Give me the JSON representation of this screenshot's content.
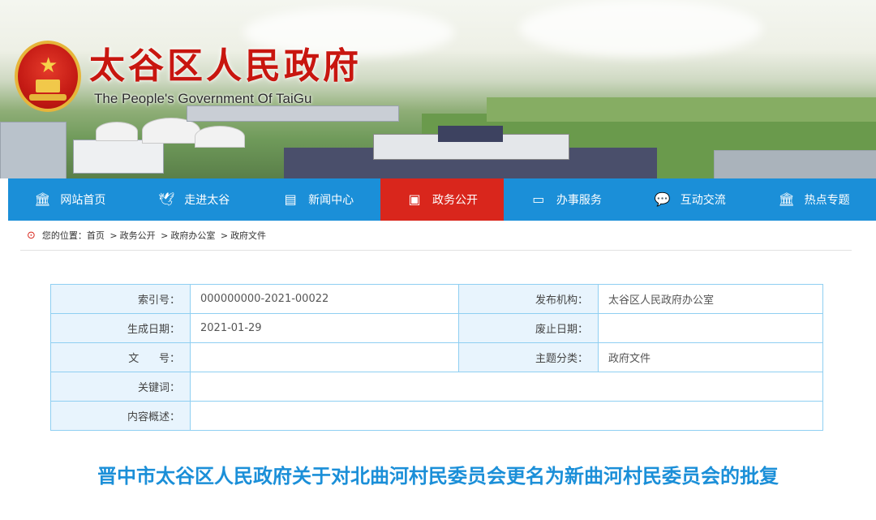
{
  "header": {
    "site_title": "太谷区人民政府",
    "site_subtitle": "The People's Government Of TaiGu"
  },
  "nav": {
    "items": [
      {
        "label": "网站首页",
        "icon": "bank-icon"
      },
      {
        "label": "走进太谷",
        "icon": "dove-icon"
      },
      {
        "label": "新闻中心",
        "icon": "newspaper-icon"
      },
      {
        "label": "政务公开",
        "icon": "document-icon"
      },
      {
        "label": "办事服务",
        "icon": "monitor-icon"
      },
      {
        "label": "互动交流",
        "icon": "chat-icon"
      },
      {
        "label": "热点专题",
        "icon": "bank-icon"
      }
    ],
    "active_index": 3
  },
  "breadcrumb": {
    "prefix": "您的位置：",
    "items": [
      "首页",
      "政务公开",
      "政府办公室",
      "政府文件"
    ],
    "separator": ">"
  },
  "info_table": {
    "index_label": "索引号：",
    "index_value": "000000000-2021-00022",
    "publisher_label": "发布机构：",
    "publisher_value": "太谷区人民政府办公室",
    "date_label": "生成日期：",
    "date_value": "2021-01-29",
    "repeal_label": "废止日期：",
    "repeal_value": "",
    "docno_label": "文      号：",
    "docno_value": "",
    "topic_label": "主题分类：",
    "topic_value": "政府文件",
    "keywords_label": "关键词：",
    "keywords_value": "",
    "summary_label": "内容概述：",
    "summary_value": ""
  },
  "document": {
    "title": "晋中市太谷区人民政府关于对北曲河村民委员会更名为新曲河村民委员会的批复"
  },
  "colors": {
    "nav_blue": "#1b8fd8",
    "nav_active_red": "#d9261c",
    "title_red": "#c8160f",
    "table_border": "#8fcff2",
    "label_bg": "#e8f4fd"
  }
}
